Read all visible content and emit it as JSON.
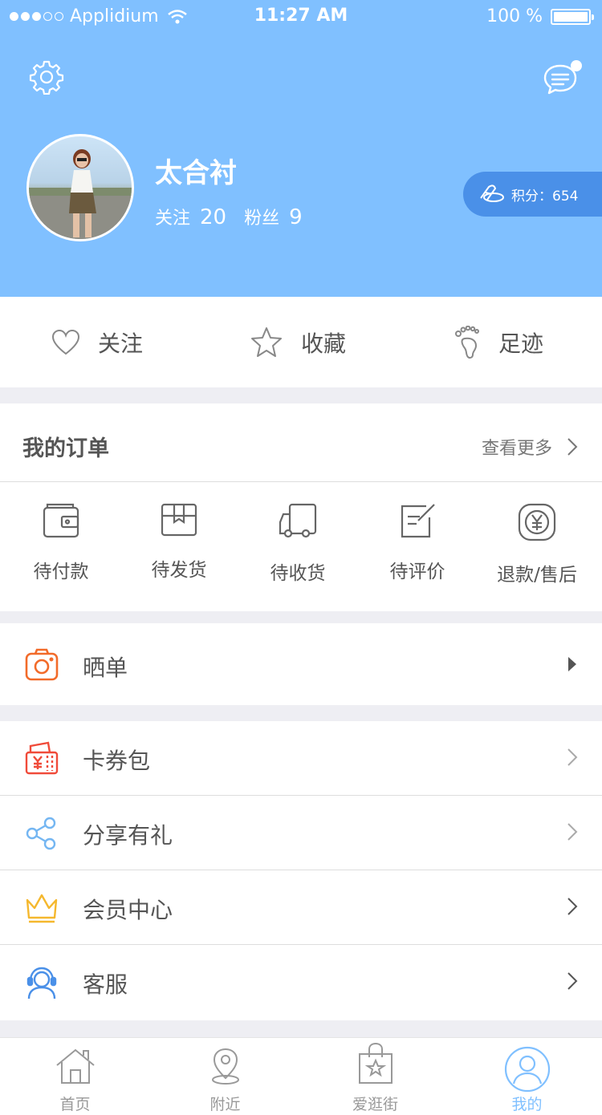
{
  "status_bar": {
    "carrier": "Applidium",
    "time": "11:27 AM",
    "battery": "100 %"
  },
  "profile": {
    "username": "太合衬",
    "following_label": "关注",
    "following_count": "20",
    "fans_label": "粉丝",
    "fans_count": "9",
    "points": "积分：654"
  },
  "quick_links": [
    {
      "label": "关注",
      "icon": "heart-icon"
    },
    {
      "label": "收藏",
      "icon": "star-icon"
    },
    {
      "label": "足迹",
      "icon": "footprint-icon"
    }
  ],
  "orders": {
    "title": "我的订单",
    "more": "查看更多",
    "items": [
      {
        "label": "待付款",
        "icon": "wallet-icon"
      },
      {
        "label": "待发货",
        "icon": "box-icon"
      },
      {
        "label": "待收货",
        "icon": "truck-icon"
      },
      {
        "label": "待评价",
        "icon": "edit-icon"
      },
      {
        "label": "退款/售后",
        "icon": "refund-icon"
      }
    ]
  },
  "menu": {
    "show_order": {
      "label": "晒单",
      "icon": "camera-icon",
      "color": "#f26b2a"
    },
    "coupons": {
      "label": "卡券包",
      "icon": "coupon-icon",
      "color": "#f04b3a"
    },
    "share": {
      "label": "分享有礼",
      "icon": "share-icon",
      "color": "#74b6f2"
    },
    "member": {
      "label": "会员中心",
      "icon": "crown-icon",
      "color": "#f5b82e"
    },
    "service": {
      "label": "客服",
      "icon": "headset-icon",
      "color": "#4a90e8"
    }
  },
  "tabbar": [
    {
      "label": "首页",
      "icon": "home-icon"
    },
    {
      "label": "附近",
      "icon": "location-icon"
    },
    {
      "label": "爱逛街",
      "icon": "shopping-bag-icon"
    },
    {
      "label": "我的",
      "icon": "user-icon",
      "active": true
    }
  ],
  "colors": {
    "header": "#80c0ff",
    "accent": "#4a90e8",
    "background": "#eeeef3"
  }
}
